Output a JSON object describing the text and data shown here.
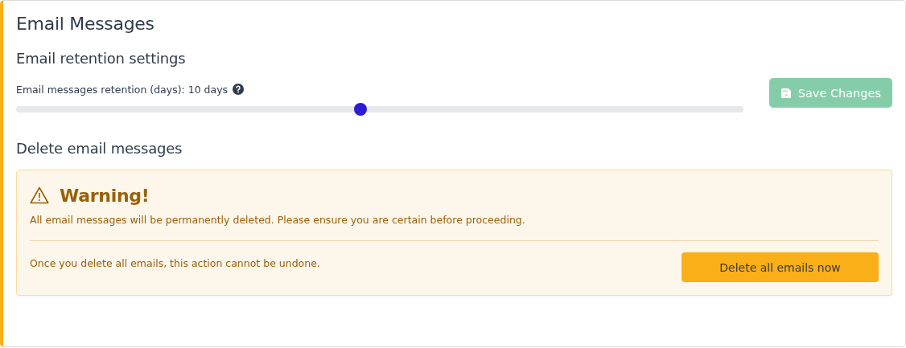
{
  "card": {
    "title": "Email Messages"
  },
  "retention": {
    "heading": "Email retention settings",
    "label": "Email messages retention (days): 10 days",
    "level": 0.474
  },
  "save_button": {
    "label": "Save Changes",
    "disabled": true
  },
  "delete": {
    "heading": "Delete email messages"
  },
  "warning": {
    "title": "Warning!",
    "message": "All email messages will be permanently deleted. Please ensure you are certain before proceeding.",
    "note": "Once you delete all emails, this action cannot be undone.",
    "button": "Delete all emails now"
  }
}
